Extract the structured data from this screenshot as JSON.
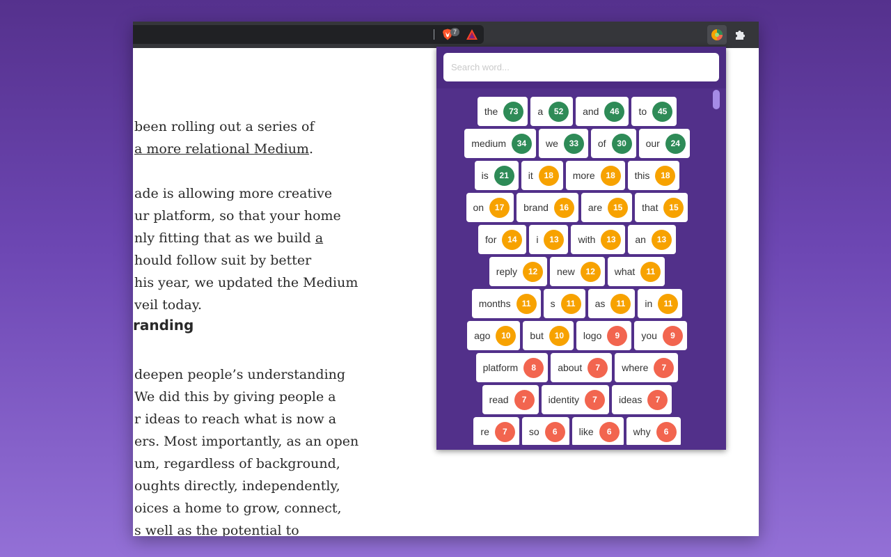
{
  "browser": {
    "brave_shields_count": "7",
    "colors": {
      "toolbar": "#35363a",
      "omnibox": "#202124"
    },
    "icons": [
      "brave-shields-icon",
      "bat-rewards-icon",
      "word-counter-extension-icon",
      "extensions-puzzle-icon"
    ]
  },
  "article": {
    "lines": [
      " been rolling out a series of",
      "a more relational Medium",
      ".",
      "ade is allowing more creative",
      "ur platform, so that your home",
      "nly fitting that as we build ",
      "a",
      "hould follow suit by better",
      "his year, we updated the Medium",
      "veil today.",
      "deepen people’s understanding",
      " We did this by giving people a",
      "r ideas to reach what is now a",
      "ers. Most importantly, as an open",
      "um, regardless of background,",
      "oughts directly, independently,",
      "oices a home to grow, connect,",
      "s well as the potential to"
    ],
    "heading": "randing"
  },
  "popup": {
    "search_placeholder": "Search word...",
    "colors": {
      "background": "#52308a",
      "high": "#2e8b57",
      "mid": "#f7a200",
      "low": "#f2654f"
    },
    "rows": [
      [
        [
          "the",
          "73",
          "green"
        ],
        [
          "a",
          "52",
          "green"
        ],
        [
          "and",
          "46",
          "green"
        ],
        [
          "to",
          "45",
          "green"
        ]
      ],
      [
        [
          "medium",
          "34",
          "green"
        ],
        [
          "we",
          "33",
          "green"
        ],
        [
          "of",
          "30",
          "green"
        ],
        [
          "our",
          "24",
          "green"
        ]
      ],
      [
        [
          "is",
          "21",
          "green"
        ],
        [
          "it",
          "18",
          "orange"
        ],
        [
          "more",
          "18",
          "orange"
        ],
        [
          "this",
          "18",
          "orange"
        ]
      ],
      [
        [
          "on",
          "17",
          "orange"
        ],
        [
          "brand",
          "16",
          "orange"
        ],
        [
          "are",
          "15",
          "orange"
        ],
        [
          "that",
          "15",
          "orange"
        ]
      ],
      [
        [
          "for",
          "14",
          "orange"
        ],
        [
          "i",
          "13",
          "orange"
        ],
        [
          "with",
          "13",
          "orange"
        ],
        [
          "an",
          "13",
          "orange"
        ]
      ],
      [
        [
          "reply",
          "12",
          "orange"
        ],
        [
          "new",
          "12",
          "orange"
        ],
        [
          "what",
          "11",
          "orange"
        ]
      ],
      [
        [
          "months",
          "11",
          "orange"
        ],
        [
          "s",
          "11",
          "orange"
        ],
        [
          "as",
          "11",
          "orange"
        ],
        [
          "in",
          "11",
          "orange"
        ]
      ],
      [
        [
          "ago",
          "10",
          "orange"
        ],
        [
          "but",
          "10",
          "orange"
        ],
        [
          "logo",
          "9",
          "red"
        ],
        [
          "you",
          "9",
          "red"
        ]
      ],
      [
        [
          "platform",
          "8",
          "red"
        ],
        [
          "about",
          "7",
          "red"
        ],
        [
          "where",
          "7",
          "red"
        ]
      ],
      [
        [
          "read",
          "7",
          "red"
        ],
        [
          "identity",
          "7",
          "red"
        ],
        [
          "ideas",
          "7",
          "red"
        ]
      ],
      [
        [
          "re",
          "7",
          "red"
        ],
        [
          "so",
          "6",
          "red"
        ],
        [
          "like",
          "6",
          "red"
        ],
        [
          "why",
          "6",
          "red"
        ]
      ]
    ]
  }
}
